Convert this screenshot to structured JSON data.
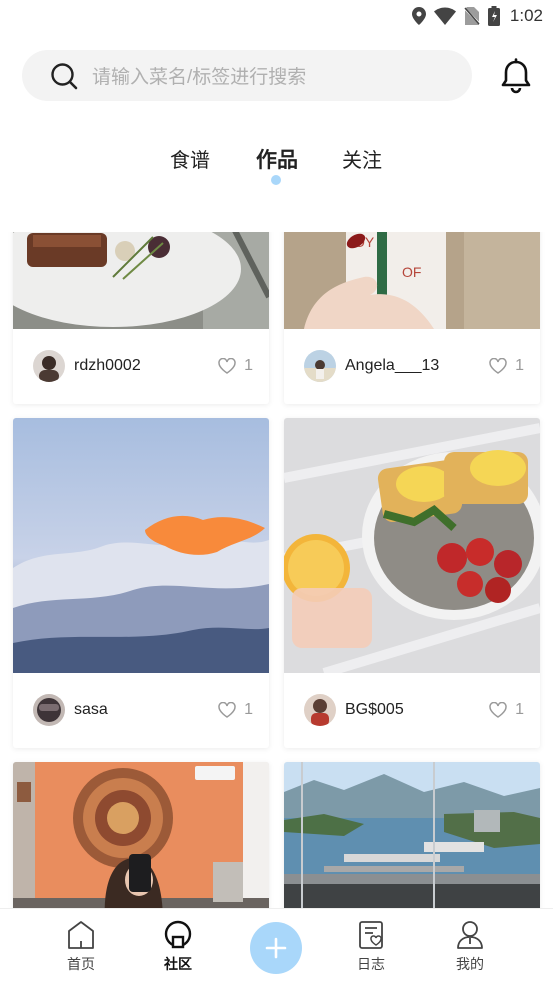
{
  "status_bar": {
    "time": "1:02",
    "icons": [
      "location-icon",
      "wifi-icon",
      "no-sim-icon",
      "battery-icon"
    ]
  },
  "header": {
    "search_placeholder": "请输入菜名/标签进行搜索",
    "icons": [
      "search-icon",
      "bell-icon"
    ]
  },
  "tabs": [
    {
      "label": "食谱",
      "active": false
    },
    {
      "label": "作品",
      "active": true
    },
    {
      "label": "关注",
      "active": false
    }
  ],
  "posts": [
    {
      "user": "rdzh0002",
      "likes": "1",
      "image": "steak-plate"
    },
    {
      "user": "Angela___13",
      "likes": "1",
      "image": "coffee-cup"
    },
    {
      "user": "sasa",
      "likes": "1",
      "image": "sky-clouds"
    },
    {
      "user": "BG$005",
      "likes": "1",
      "image": "eggs-benedict"
    },
    {
      "user": "",
      "likes": "",
      "image": "mirror-selfie"
    },
    {
      "user": "",
      "likes": "",
      "image": "harbor-view"
    }
  ],
  "bottom_nav": {
    "items": [
      {
        "label": "首页",
        "icon": "home-icon",
        "active": false
      },
      {
        "label": "社区",
        "icon": "community-icon",
        "active": true
      },
      {
        "label": "日志",
        "icon": "journal-icon",
        "active": false
      },
      {
        "label": "我的",
        "icon": "profile-icon",
        "active": false
      }
    ],
    "add_icon": "plus-icon"
  },
  "colors": {
    "accent": "#a9d7fa",
    "search_bg": "#f3f3f3",
    "placeholder": "#b0b0b0",
    "like_gray": "#9a9a9a"
  }
}
